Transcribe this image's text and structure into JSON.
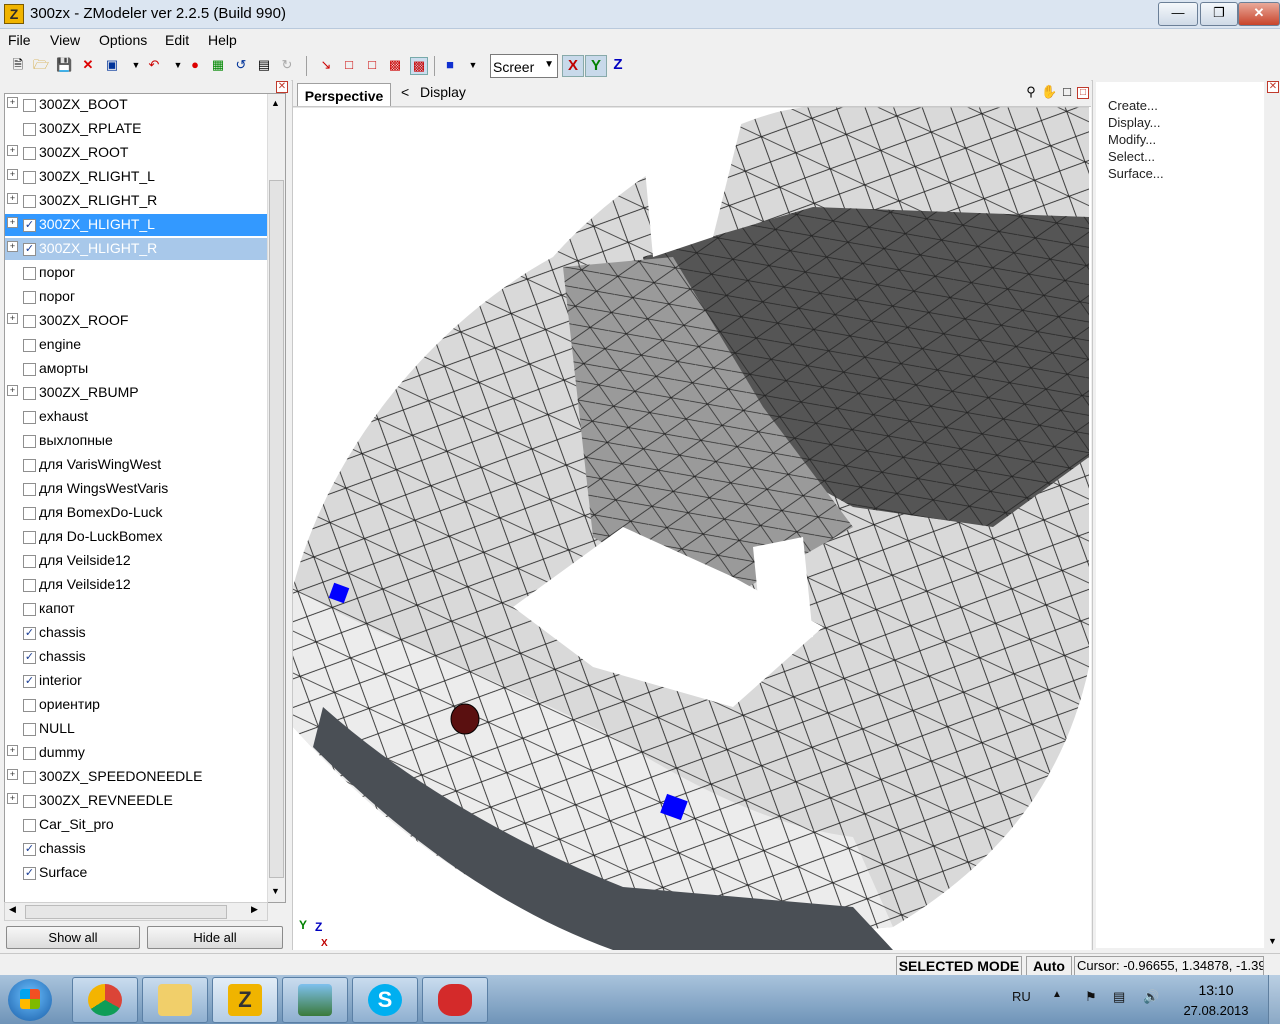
{
  "window": {
    "title": "300zx - ZModeler ver 2.2.5 (Build 990)",
    "app_icon": "Z"
  },
  "menu": [
    "File",
    "View",
    "Options",
    "Edit",
    "Help"
  ],
  "toolbar": {
    "view_mode": "Screer",
    "axis": [
      "X",
      "Y",
      "Z"
    ]
  },
  "tree": {
    "items": [
      {
        "label": "300ZX_BOOT",
        "expandable": true,
        "checked": false
      },
      {
        "label": "300ZX_RPLATE",
        "expandable": false,
        "checked": false
      },
      {
        "label": "300ZX_ROOT",
        "expandable": true,
        "checked": false
      },
      {
        "label": "300ZX_RLIGHT_L",
        "expandable": true,
        "checked": false
      },
      {
        "label": "300ZX_RLIGHT_R",
        "expandable": true,
        "checked": false
      },
      {
        "label": "300ZX_HLIGHT_L",
        "expandable": true,
        "checked": true,
        "selected": "primary"
      },
      {
        "label": "300ZX_HLIGHT_R",
        "expandable": true,
        "checked": true,
        "selected": "secondary"
      },
      {
        "label": "порог",
        "expandable": false,
        "checked": false
      },
      {
        "label": "порог",
        "expandable": false,
        "checked": false
      },
      {
        "label": "300ZX_ROOF",
        "expandable": true,
        "checked": false
      },
      {
        "label": "engine",
        "expandable": false,
        "checked": false
      },
      {
        "label": "аморты",
        "expandable": false,
        "checked": false
      },
      {
        "label": "300ZX_RBUMP",
        "expandable": true,
        "checked": false
      },
      {
        "label": "exhaust",
        "expandable": false,
        "checked": false
      },
      {
        "label": "выхлопные",
        "expandable": false,
        "checked": false
      },
      {
        "label": "для VarisWingWest",
        "expandable": false,
        "checked": false
      },
      {
        "label": "для WingsWestVaris",
        "expandable": false,
        "checked": false
      },
      {
        "label": "для BomexDo-Luck",
        "expandable": false,
        "checked": false
      },
      {
        "label": "для Do-LuckBomex",
        "expandable": false,
        "checked": false
      },
      {
        "label": "для Veilside12",
        "expandable": false,
        "checked": false
      },
      {
        "label": "для Veilside12",
        "expandable": false,
        "checked": false
      },
      {
        "label": "капот",
        "expandable": false,
        "checked": false
      },
      {
        "label": "chassis",
        "expandable": false,
        "checked": true
      },
      {
        "label": "chassis",
        "expandable": false,
        "checked": true
      },
      {
        "label": "interior",
        "expandable": false,
        "checked": true
      },
      {
        "label": "ориентир",
        "expandable": false,
        "checked": false
      },
      {
        "label": "NULL",
        "expandable": false,
        "checked": false
      },
      {
        "label": "dummy",
        "expandable": true,
        "checked": false
      },
      {
        "label": "300ZX_SPEEDONEEDLE",
        "expandable": true,
        "checked": false
      },
      {
        "label": "300ZX_REVNEEDLE",
        "expandable": true,
        "checked": false
      },
      {
        "label": "Car_Sit_pro",
        "expandable": false,
        "checked": false
      },
      {
        "label": "chassis",
        "expandable": false,
        "checked": true
      },
      {
        "label": "Surface",
        "expandable": false,
        "checked": true
      }
    ],
    "show_all": "Show all",
    "hide_all": "Hide all"
  },
  "viewport": {
    "tab_perspective": "Perspective",
    "tab_display": "Display",
    "tab_arrow": "<",
    "axis_gizmo": [
      "Y",
      "Z",
      "X"
    ]
  },
  "right_panel": {
    "items": [
      "Create...",
      "Display...",
      "Modify...",
      "Select...",
      "Surface..."
    ]
  },
  "status": {
    "mode": "SELECTED MODE",
    "auto": "Auto",
    "cursor": "Cursor: -0.96655, 1.34878, -1.39"
  },
  "taskbar": {
    "lang": "RU",
    "time": "13:10",
    "date": "27.08.2013",
    "apps": [
      "chrome",
      "explorer",
      "zmodeler",
      "photo-viewer",
      "skype",
      "paint-app"
    ]
  },
  "colors": {
    "selection": "#3399ff",
    "selection_inactive": "#a8c8ea",
    "x_axis": "#c00000",
    "y_axis": "#008000",
    "z_axis": "#0000c0"
  }
}
